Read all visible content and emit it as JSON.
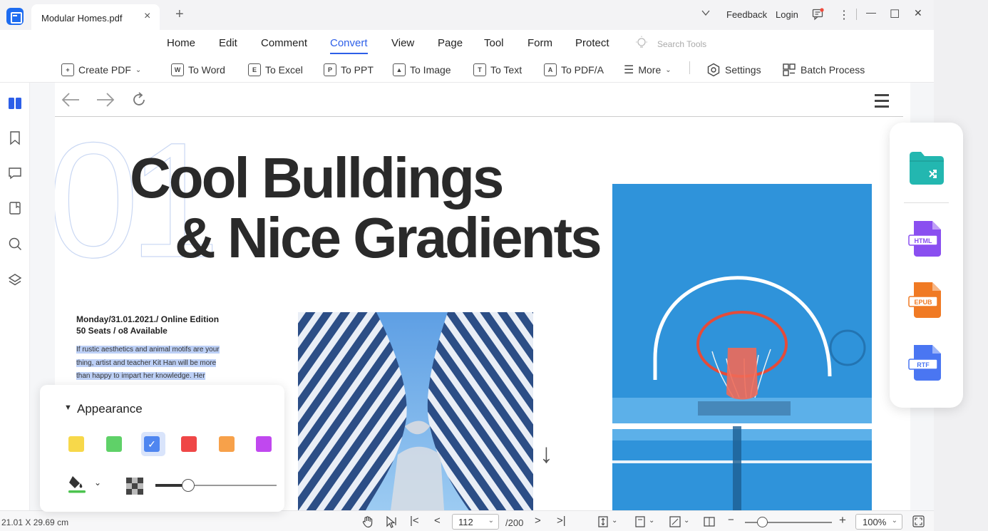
{
  "titlebar": {
    "tab_title": "Modular Homes.pdf",
    "close_glyph": "×",
    "add_glyph": "+",
    "feedback": "Feedback",
    "login": "Login",
    "more_glyph": "⋮",
    "minimize_glyph": "—",
    "maximize_glyph": "☐",
    "close_window_glyph": "✕"
  },
  "menu": {
    "items": [
      "Home",
      "Edit",
      "Comment",
      "Convert",
      "View",
      "Page",
      "Tool",
      "Form",
      "Protect"
    ],
    "active": "Convert",
    "search_placeholder": "Search Tools"
  },
  "toolbar": {
    "create_pdf": "Create PDF",
    "to_word": "To Word",
    "to_excel": "To Excel",
    "to_ppt": "To PPT",
    "to_image": "To Image",
    "to_text": "To Text",
    "to_pdfa": "To PDF/A",
    "more": "More",
    "settings": "Settings",
    "batch_process": "Batch Process"
  },
  "sidebar": {
    "icons": [
      "thumbnails-icon",
      "bookmark-icon",
      "comment-icon",
      "attachment-icon",
      "search-icon",
      "layers-icon"
    ]
  },
  "document": {
    "big_number": "01",
    "headline_line1": "Cool Bulldings",
    "headline_line2": "& Nice Gradients",
    "meta_line1": "Monday/31.01.2021./ Online Edition",
    "meta_line2": "50 Seats / o8 Available",
    "body_line1": "If rustic aesthetics and animal motifs are your",
    "body_line2": "thing, artist and teacher Kit Han will be more",
    "body_line3": "than happy to impart her knowledge. Her",
    "down_arrow": "↓"
  },
  "appearance": {
    "title": "Appearance",
    "swatches": [
      "#f7d84a",
      "#5fd168",
      "#4f86f0",
      "#ef4747",
      "#f7a14a",
      "#c048ef"
    ],
    "selected_index": 2,
    "fill_color": "#4cc34f",
    "opacity_level": 0.27
  },
  "convert_panel": {
    "formats": [
      "HTML",
      "EPUB",
      "RTF"
    ]
  },
  "statusbar": {
    "dimensions": "21.01 X 29.69 cm",
    "page_current": "112",
    "page_total": "/200",
    "zoom": "100%",
    "zoom_level": 0.2
  }
}
